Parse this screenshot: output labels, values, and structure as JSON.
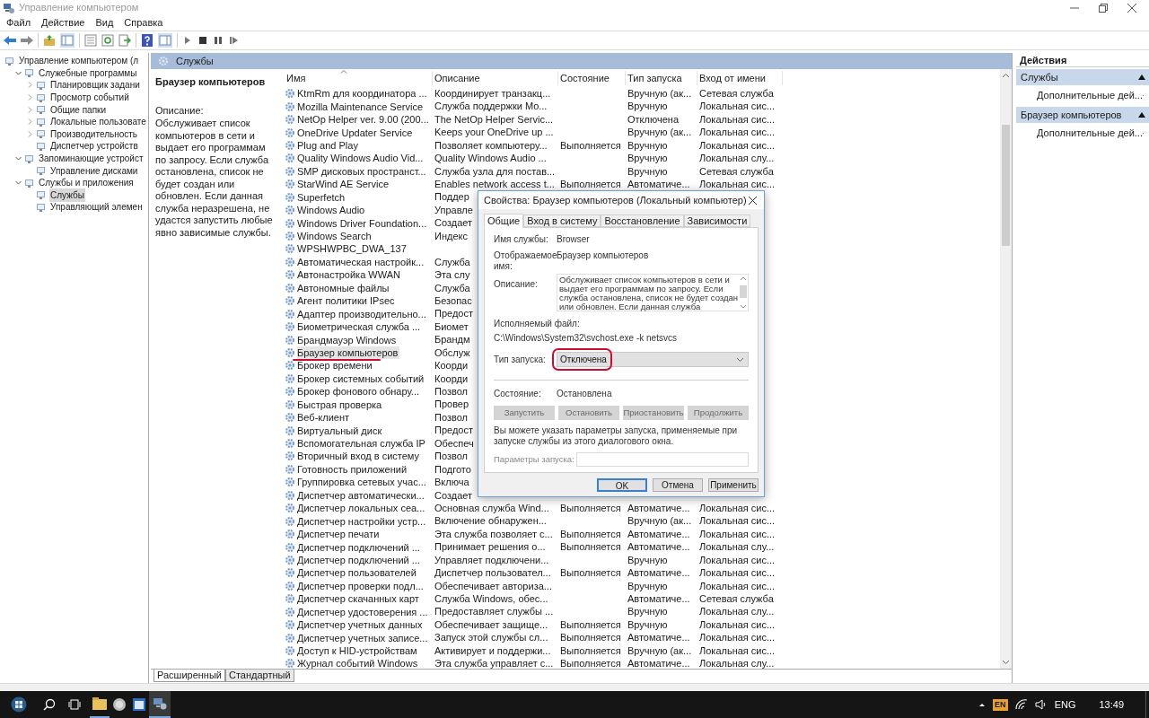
{
  "window": {
    "title": "Управление компьютером"
  },
  "menu": [
    "Файл",
    "Действие",
    "Вид",
    "Справка"
  ],
  "tree": {
    "items": [
      {
        "label": "Управление компьютером (л",
        "selected": false,
        "children": [
          {
            "label": "Служебные программы",
            "expanded": true,
            "selected": false,
            "children": [
              {
                "label": "Планировщик задани",
                "expanded": false,
                "selected": false
              },
              {
                "label": "Просмотр событий",
                "expanded": false,
                "selected": false
              },
              {
                "label": "Общие папки",
                "expanded": false,
                "selected": false
              },
              {
                "label": "Локальные пользовате",
                "expanded": false,
                "selected": false
              },
              {
                "label": "Производительность",
                "expanded": false,
                "selected": false
              },
              {
                "label": "Диспетчер устройств",
                "selected": false
              }
            ]
          },
          {
            "label": "Запоминающие устройст",
            "expanded": true,
            "selected": false,
            "children": [
              {
                "label": "Управление дисками",
                "selected": false
              }
            ]
          },
          {
            "label": "Службы и приложения",
            "expanded": true,
            "selected": false,
            "children": [
              {
                "label": "Службы",
                "selected": true
              },
              {
                "label": "Управляющий элемен",
                "selected": false
              }
            ]
          }
        ]
      }
    ]
  },
  "services": {
    "title": "Службы",
    "detail": {
      "heading": "Браузер компьютеров",
      "label": "Описание:",
      "text": "Обслуживает список компьютеров в сети и выдает его программам по запросу. Если служба остановлена, список не будет создан или обновлен. Если данная служба неразрешена, не удастся запустить любые явно зависимые службы."
    },
    "columns": [
      {
        "label": "Имя",
        "sorted": true
      },
      {
        "label": "Описание",
        "sorted": false
      },
      {
        "label": "Состояние",
        "sorted": false
      },
      {
        "label": "Тип запуска",
        "sorted": false
      },
      {
        "label": "Вход от имени",
        "sorted": false
      }
    ],
    "rows": [
      {
        "name": "KtmRm для координатора ...",
        "description": "Координирует транзакц...",
        "startup": "Вручную (ак...",
        "logon": "Сетевая служба",
        "selected": false
      },
      {
        "name": "Mozilla Maintenance Service",
        "description": "Служба поддержки Mo...",
        "startup": "Вручную",
        "logon": "Локальная сис...",
        "selected": false
      },
      {
        "name": "NetOp Helper ver. 9.00 (200...",
        "description": "The NetOp Helper Servic...",
        "startup": "Отключена",
        "logon": "Локальная сис...",
        "selected": false
      },
      {
        "name": "OneDrive Updater Service",
        "description": "Keeps your OneDrive up ...",
        "startup": "Вручную (ак...",
        "logon": "Локальная сис...",
        "selected": false
      },
      {
        "name": "Plug and Play",
        "description": "Позволяет компьютеру...",
        "status": "Выполняется",
        "startup": "Вручную",
        "logon": "Локальная сис...",
        "selected": false
      },
      {
        "name": "Quality Windows Audio Vid...",
        "description": "Quality Windows Audio ...",
        "startup": "Вручную",
        "logon": "Локальная слу...",
        "selected": false
      },
      {
        "name": "SMP дисковых пространст...",
        "description": "Служба узла для постав...",
        "startup": "Вручную",
        "logon": "Сетевая служба",
        "selected": false
      },
      {
        "name": "StarWind AE Service",
        "description": "Enables network access t...",
        "status": "Выполняется",
        "startup": "Автоматиче...",
        "logon": "Локальная сис...",
        "selected": false
      },
      {
        "name": "Superfetch",
        "description": "Поддер",
        "selected": false
      },
      {
        "name": "Windows Audio",
        "description": "Управле",
        "selected": false
      },
      {
        "name": "Windows Driver Foundation...",
        "description": "Создает",
        "selected": false
      },
      {
        "name": "Windows Search",
        "description": "Индекс",
        "selected": false
      },
      {
        "name": "WPSHWPBC_DWA_137",
        "selected": false
      },
      {
        "name": "Автоматическая настройк...",
        "description": "Служба",
        "selected": false
      },
      {
        "name": "Автонастройка WWAN",
        "description": "Эта слу",
        "selected": false
      },
      {
        "name": "Автономные файлы",
        "description": "Служба",
        "selected": false
      },
      {
        "name": "Агент политики IPsec",
        "description": "Безопас",
        "selected": false
      },
      {
        "name": "Адаптер производительно...",
        "description": "Предост",
        "selected": false
      },
      {
        "name": "Биометрическая служба ...",
        "description": "Биомет",
        "selected": false
      },
      {
        "name": "Брандмауэр Windows",
        "description": "Брандм",
        "selected": false
      },
      {
        "name": "Браузер компьютеров",
        "description": "Обслуж",
        "selected": true
      },
      {
        "name": "Брокер времени",
        "description": "Коорди",
        "selected": false
      },
      {
        "name": "Брокер системных событий",
        "description": "Коорди",
        "selected": false
      },
      {
        "name": "Брокер фонового обнару...",
        "description": "Позвол",
        "selected": false
      },
      {
        "name": "Быстрая проверка",
        "description": "Провер",
        "selected": false
      },
      {
        "name": "Веб-клиент",
        "description": "Позвол",
        "selected": false
      },
      {
        "name": "Виртуальный диск",
        "description": "Предост",
        "selected": false
      },
      {
        "name": "Вспомогательная служба IP",
        "description": "Обеспеч",
        "selected": false
      },
      {
        "name": "Вторичный вход в систему",
        "description": "Позвол",
        "selected": false
      },
      {
        "name": "Готовность приложений",
        "description": "Подгото",
        "selected": false
      },
      {
        "name": "Группировка сетевых учас...",
        "description": "Включа",
        "selected": false
      },
      {
        "name": "Диспетчер автоматически...",
        "description": "Создает",
        "selected": false
      },
      {
        "name": "Диспетчер локальных сеа...",
        "description": "Основная служба Wind...",
        "status": "Выполняется",
        "startup": "Автоматиче...",
        "logon": "Локальная сис...",
        "selected": false
      },
      {
        "name": "Диспетчер настройки устр...",
        "description": "Включение обнаружен...",
        "startup": "Вручную (ак...",
        "logon": "Локальная сис...",
        "selected": false
      },
      {
        "name": "Диспетчер печати",
        "description": "Эта служба позволяет с...",
        "status": "Выполняется",
        "startup": "Автоматиче...",
        "logon": "Локальная сис...",
        "selected": false
      },
      {
        "name": "Диспетчер подключений ...",
        "description": "Принимает решения о...",
        "status": "Выполняется",
        "startup": "Автоматиче...",
        "logon": "Локальная слу...",
        "selected": false
      },
      {
        "name": "Диспетчер подключений ...",
        "description": "Управляет подключени...",
        "startup": "Вручную",
        "logon": "Локальная сис...",
        "selected": false
      },
      {
        "name": "Диспетчер пользователей",
        "description": "Диспетчер пользовател...",
        "status": "Выполняется",
        "startup": "Автоматиче...",
        "logon": "Локальная сис...",
        "selected": false
      },
      {
        "name": "Диспетчер проверки подл...",
        "description": "Обеспечивает авториза...",
        "startup": "Вручную",
        "logon": "Локальная сис...",
        "selected": false
      },
      {
        "name": "Диспетчер скачанных карт",
        "description": "Служба Windows, обес...",
        "startup": "Автоматиче...",
        "logon": "Сетевая служба",
        "selected": false
      },
      {
        "name": "Диспетчер удостоверения ...",
        "description": "Предоставляет службы ...",
        "startup": "Вручную",
        "logon": "Локальная слу...",
        "selected": false
      },
      {
        "name": "Диспетчер учетных данных",
        "description": "Обеспечивает защище...",
        "status": "Выполняется",
        "startup": "Вручную",
        "logon": "Локальная сис...",
        "selected": false
      },
      {
        "name": "Диспетчер учетных записе...",
        "description": "Запуск этой службы сл...",
        "status": "Выполняется",
        "startup": "Автоматиче...",
        "logon": "Локальная сис...",
        "selected": false
      },
      {
        "name": "Доступ к HID-устройствам",
        "description": "Активирует и поддержи...",
        "status": "Выполняется",
        "startup": "Вручную (ак...",
        "logon": "Локальная сис...",
        "selected": false
      },
      {
        "name": "Журнал событий Windows",
        "description": "Эта служба управляет с...",
        "status": "Выполняется",
        "startup": "Автоматиче...",
        "logon": "Локальная слу...",
        "selected": false
      }
    ]
  },
  "view_tabs": [
    {
      "label": "Расширенный",
      "selected": true
    },
    {
      "label": "Стандартный",
      "selected": false
    }
  ],
  "actions": {
    "title": "Действия",
    "sections": [
      {
        "title": "Службы",
        "items": [
          "Дополнительные дей..."
        ]
      },
      {
        "title": "Браузер компьютеров",
        "items": [
          "Дополнительные дей..."
        ]
      }
    ]
  },
  "dialog": {
    "title": "Свойства: Браузер компьютеров (Локальный компьютер)",
    "tabs": [
      {
        "label": "Общие",
        "selected": true
      },
      {
        "label": "Вход в систему",
        "selected": false
      },
      {
        "label": "Восстановление",
        "selected": false
      },
      {
        "label": "Зависимости",
        "selected": false
      }
    ],
    "service_name": {
      "label": "Имя службы:",
      "value": "Browser"
    },
    "display_name": {
      "label": "Отображаемое имя:",
      "value": "Браузер компьютеров"
    },
    "description": {
      "label": "Описание:",
      "value": "Обслуживает список компьютеров в сети и выдает его программам по запросу. Если служба остановлена, список не будет создан или обновлен. Если данная служба"
    },
    "executable": {
      "label": "Исполняемый файл:",
      "value": "C:\\Windows\\System32\\svchost.exe -k netsvcs"
    },
    "startup_type": {
      "label": "Тип запуска:",
      "value": "Отключена"
    },
    "status": {
      "label": "Состояние:",
      "value": "Остановлена"
    },
    "control_buttons": [
      {
        "label": "Запустить",
        "disabled": true
      },
      {
        "label": "Остановить",
        "disabled": true
      },
      {
        "label": "Приостановить",
        "disabled": true
      },
      {
        "label": "Продолжить",
        "disabled": true
      }
    ],
    "note": "Вы можете указать параметры запуска, применяемые при запуске службы из этого диалогового окна.",
    "start_params": {
      "label": "Параметры запуска:",
      "disabled": true
    },
    "footer_buttons": [
      {
        "label": "OK",
        "default": true
      },
      {
        "label": "Отмена",
        "default": false
      },
      {
        "label": "Применить",
        "default": false
      }
    ]
  },
  "taskbar": {
    "input_badge": "EN",
    "language": "ENG",
    "time": "13:49"
  }
}
